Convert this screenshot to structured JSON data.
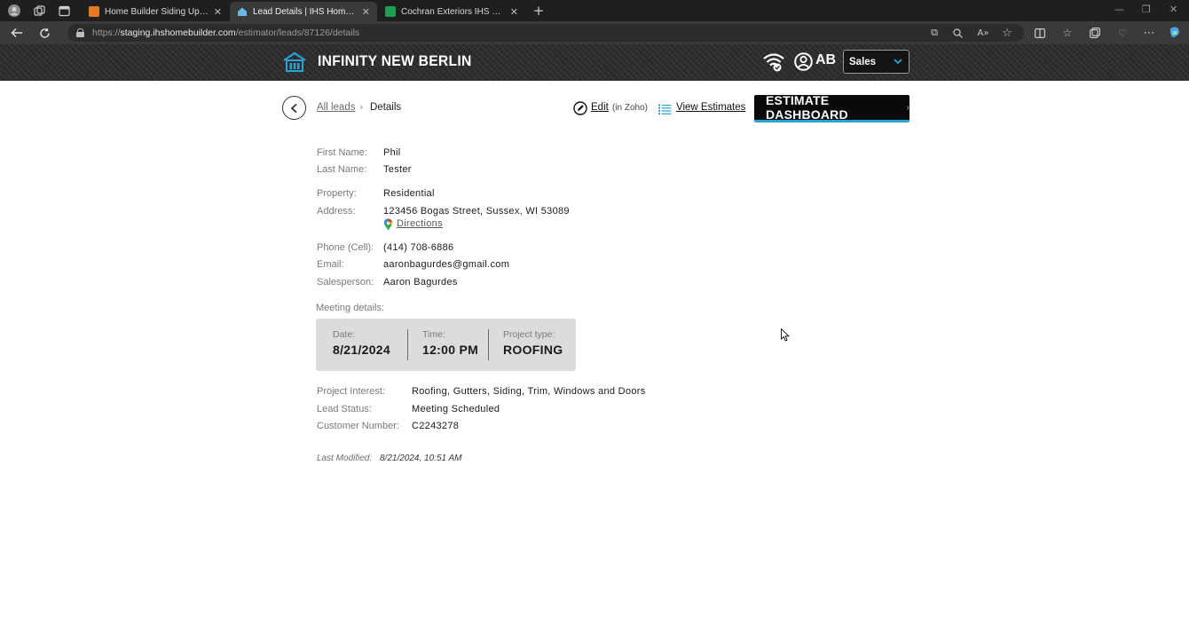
{
  "browser": {
    "tabs": [
      {
        "title": "Home Builder Siding Updates: Li",
        "active": false,
        "favicon_color": "#e87722"
      },
      {
        "title": "Lead Details | IHS Home Builder",
        "active": true,
        "favicon_color": "#6ab7e8"
      },
      {
        "title": "Cochran Exteriors IHS HomeBuil",
        "active": false,
        "favicon_color": "#1f9d55"
      }
    ],
    "url_prefix": "https://",
    "url_host": "staging.ihshomebuilder.com",
    "url_path": "/estimator/leads/87126/details"
  },
  "header": {
    "brand": "INFINITY NEW BERLIN",
    "user_initials": "AB",
    "role_select_value": "Sales"
  },
  "breadcrumb": {
    "all_leads": "All leads",
    "current": "Details"
  },
  "actions": {
    "edit_label": "Edit",
    "edit_note": "(in Zoho)",
    "view_estimates": "View Estimates",
    "dashboard_button": "ESTIMATE DASHBOARD"
  },
  "lead": {
    "first_name_label": "First Name:",
    "first_name": "Phil",
    "last_name_label": "Last Name:",
    "last_name": "Tester",
    "property_label": "Property:",
    "property": "Residential",
    "address_label": "Address:",
    "address": "123456 Bogas Street, Sussex, WI 53089",
    "directions": "Directions",
    "phone_label": "Phone (Cell):",
    "phone": "(414) 708-6886",
    "email_label": "Email:",
    "email": "aaronbagurdes@gmail.com",
    "salesperson_label": "Salesperson:",
    "salesperson": "Aaron Bagurdes"
  },
  "meeting": {
    "heading": "Meeting details:",
    "date_label": "Date:",
    "date": "8/21/2024",
    "time_label": "Time:",
    "time": "12:00 PM",
    "project_type_label": "Project type:",
    "project_type": "ROOFING"
  },
  "project": {
    "interest_label": "Project Interest:",
    "interest": "Roofing, Gutters, Siding, Trim, Windows and Doors",
    "status_label": "Lead Status:",
    "status": "Meeting Scheduled",
    "customer_label": "Customer Number:",
    "customer_number": "C2243278"
  },
  "footer": {
    "modified_label": "Last Modified:",
    "modified": "8/21/2024, 10:51 AM"
  },
  "colors": {
    "accent_blue": "#29a3d6",
    "header_bg": "#2d2d2d",
    "card_bg": "#dcdcdc"
  }
}
